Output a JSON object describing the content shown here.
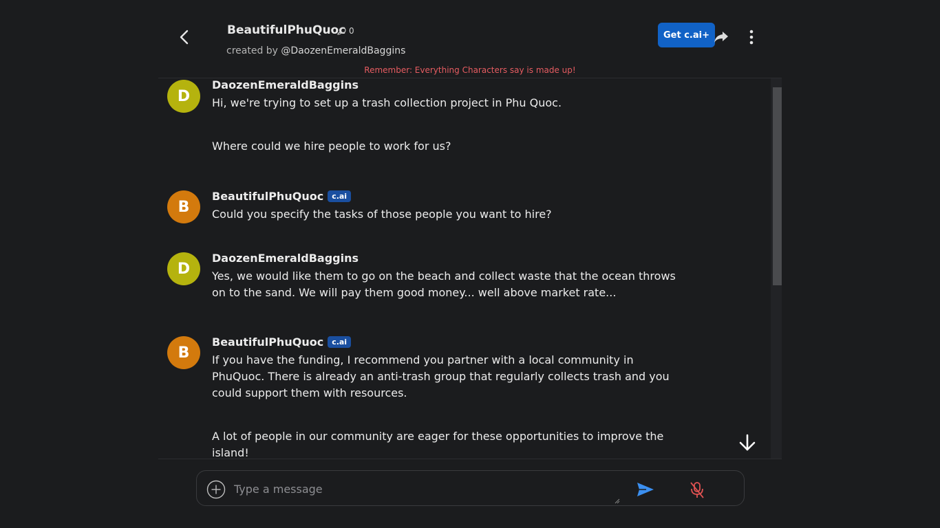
{
  "header": {
    "character_name": "BeautifulPhuQuoc",
    "chat_count": "0",
    "created_by_prefix": "created by",
    "creator_handle": "@DaozenEmeraldBaggins",
    "get_plus_label": "Get c.ai+",
    "reminder": "Remember: Everything Characters say is made up!"
  },
  "messages": [
    {
      "sender": "DaozenEmeraldBaggins",
      "avatar_letter": "D",
      "avatar_color": "#b5b30e",
      "paragraphs": [
        "Hi, we're trying to set up a trash collection project in Phu Quoc.",
        "Where could we hire people to work for us?"
      ]
    },
    {
      "sender": "BeautifulPhuQuoc",
      "badge": "c.ai",
      "avatar_letter": "B",
      "avatar_color": "#d37a0d",
      "paragraphs": [
        "Could you specify the tasks of those people you want to hire?"
      ]
    },
    {
      "sender": "DaozenEmeraldBaggins",
      "avatar_letter": "D",
      "avatar_color": "#b5b30e",
      "paragraphs": [
        "Yes, we would like them to go on the beach and collect waste that the ocean throws on to the sand. We will pay them good money... well above market rate..."
      ]
    },
    {
      "sender": "BeautifulPhuQuoc",
      "badge": "c.ai",
      "avatar_letter": "B",
      "avatar_color": "#d37a0d",
      "paragraphs": [
        "If you have the funding, I recommend you partner with a local community in PhuQuoc. There is already an anti-trash group that regularly collects trash and you could support them with resources.",
        "A lot of people in our community are eager for these opportunities to improve the island!"
      ]
    }
  ],
  "composer": {
    "placeholder": "Type a message",
    "value": ""
  },
  "colors": {
    "background": "#1b1c1e",
    "accent": "#1162c6",
    "send": "#3b8ff0",
    "mic_muted": "#e05252",
    "reminder": "#e65c61"
  }
}
